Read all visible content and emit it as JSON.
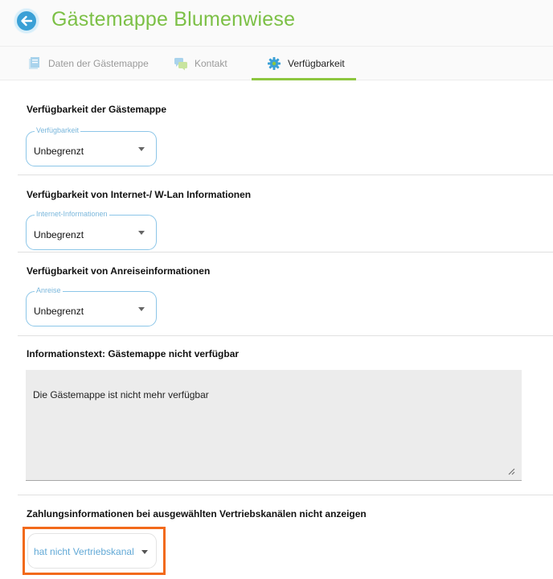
{
  "header": {
    "title": "Gästemappe Blumenwiese",
    "back_icon": "arrow-left-icon"
  },
  "tabs": [
    {
      "label": "Daten der Gästemappe",
      "icon": "document-icon",
      "active": false
    },
    {
      "label": "Kontakt",
      "icon": "chat-icon",
      "active": false
    },
    {
      "label": "Verfügbarkeit",
      "icon": "gear-icon",
      "active": true
    }
  ],
  "sections": {
    "availability": {
      "title": "Verfügbarkeit der Gästemappe",
      "select_label": "Verfügbarkeit",
      "select_value": "Unbegrenzt"
    },
    "internet": {
      "title": "Verfügbarkeit von Internet-/ W-Lan Informationen",
      "select_label": "Internet-Informationen",
      "select_value": "Unbegrenzt"
    },
    "arrival": {
      "title": "Verfügbarkeit von Anreiseinformationen",
      "select_label": "Anreise",
      "select_value": "Unbegrenzt"
    },
    "info_text": {
      "title": "Informationstext: Gästemappe nicht verfügbar",
      "value": "Die Gästemappe ist nicht mehr verfügbar"
    },
    "payment": {
      "title": "Zahlungsinformationen bei ausgewählten Vertriebskanälen nicht anzeigen",
      "select_value": "hat nicht Vertriebskanal"
    }
  },
  "colors": {
    "brand_green": "#7cc046",
    "accent_blue": "#3aa0d6",
    "highlight_orange": "#f26a1b"
  }
}
